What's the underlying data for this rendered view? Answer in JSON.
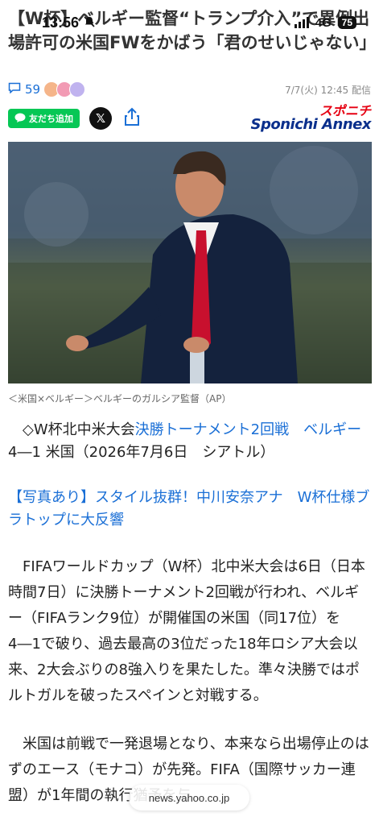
{
  "status_bar": {
    "time": "13:56",
    "network": "4G",
    "battery": "75"
  },
  "article": {
    "headline": "【W杯】ベルギー監督“トランプ介入”で異例出場許可の米国FWをかばう「君のせいじゃない」",
    "comment_count": "59",
    "date": "7/7(火) 12:45 配信",
    "line_button": "友だち追加",
    "x_button": "𝕏",
    "logo_jp": "スポニチ",
    "logo_en": "Sponichi Annex",
    "image_caption": "＜米国×ベルギー＞ベルギーのガルシア監督（AP）",
    "intro_prefix": "◇W杯北中米大会",
    "intro_link": "決勝トーナメント2回戦",
    "intro_gap": "　",
    "intro_team": "ベルギー",
    "intro_rest": " 4―1 米国（2026年7月6日　シアトル）",
    "related_link": "【写真あり】スタイル抜群！中川安奈アナ　W杯仕様ブラトップに大反響",
    "paragraph1": "FIFAワールドカップ（W杯）北中米大会は6日（日本時間7日）に決勝トーナメント2回戦が行われ、ベルギー（FIFAランク9位）が開催国の米国（同17位）を4―1で破り、過去最高の3位だった18年ロシア大会以来、2大会ぶりの8強入りを果たした。準々決勝ではポルトガルを破ったスペインと対戦する。",
    "paragraph2": "米国は前戦で一発退場となり、本来なら出場停止のはずのエース（モナコ）が先発。FIFA（国際サッカー連盟）が1年間の執行猶予を与"
  },
  "browser": {
    "url": "news.yahoo.co.jp"
  },
  "colors": {
    "link": "#1a6fd6",
    "line_green": "#06c755",
    "logo_red": "#e60012",
    "logo_blue": "#0a2f8c"
  }
}
